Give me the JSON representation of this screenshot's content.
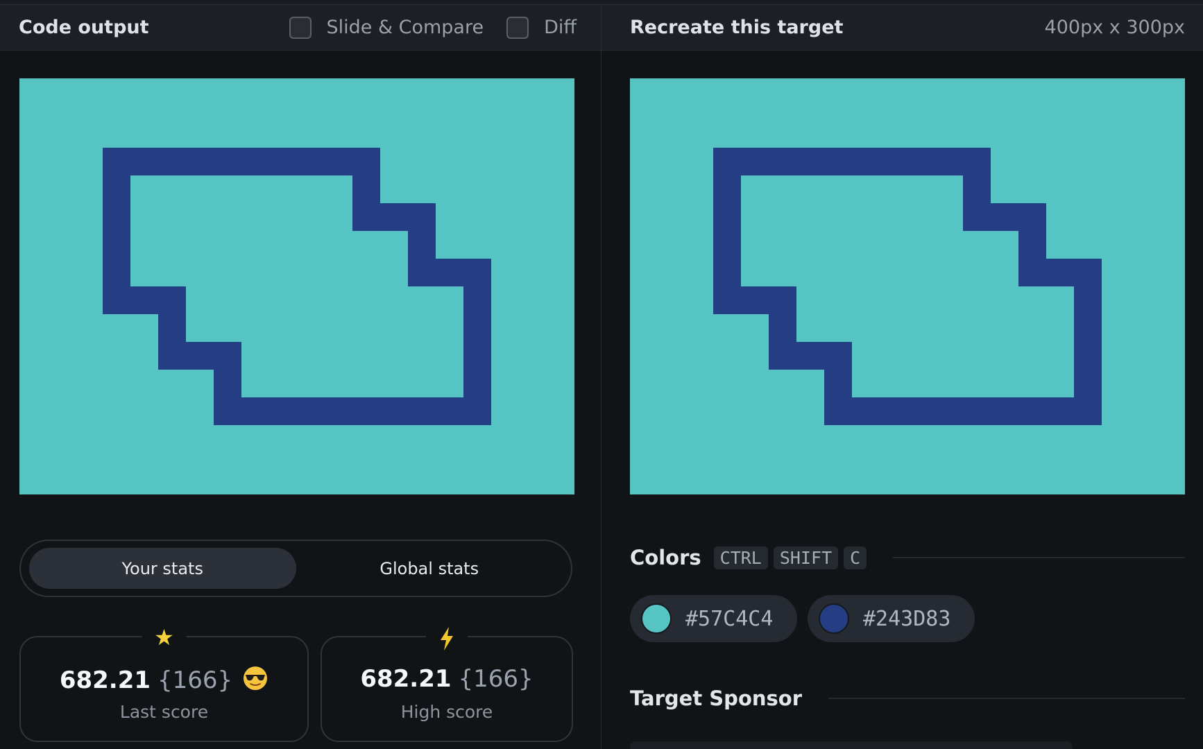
{
  "left_panel": {
    "title": "Code output",
    "slide_compare_label": "Slide & Compare",
    "diff_label": "Diff"
  },
  "right_panel": {
    "title": "Recreate this target",
    "dimensions": "400px x 300px"
  },
  "target_colors": {
    "background": "#57C4C4",
    "shape": "#243D83"
  },
  "stats": {
    "tabs": [
      "Your stats",
      "Global stats"
    ],
    "active_tab": "Your stats",
    "last_score": {
      "value": "682.21",
      "count": "{166}",
      "label": "Last score",
      "icon": "star-icon",
      "emoji": "sunglasses-emoji"
    },
    "high_score": {
      "value": "682.21",
      "count": "{166}",
      "label": "High score",
      "icon": "lightning-icon"
    }
  },
  "colors_section": {
    "title": "Colors",
    "shortcut_keys": [
      "CTRL",
      "SHIFT",
      "C"
    ],
    "swatches": [
      {
        "hex": "#57C4C4"
      },
      {
        "hex": "#243D83"
      }
    ]
  },
  "sponsor_section": {
    "title": "Target Sponsor"
  }
}
